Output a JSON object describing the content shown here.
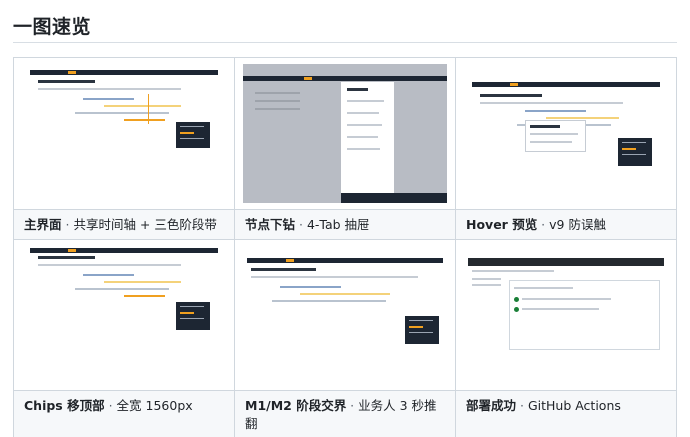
{
  "heading": "一图速览",
  "cards": [
    {
      "title": "主界面",
      "sep": " · ",
      "desc": "共享时间轴 + 三色阶段带"
    },
    {
      "title": "节点下钻",
      "sep": " · ",
      "desc": "4-Tab 抽屉"
    },
    {
      "title": "Hover 预览",
      "sep": " · ",
      "desc": "v9 防误触"
    },
    {
      "title": "Chips 移顶部",
      "sep": " · ",
      "desc": "全宽 1560px"
    },
    {
      "title": "M1/M2 阶段交界",
      "sep": " · ",
      "desc": "业务人 3 秒推翻"
    },
    {
      "title": "部署成功",
      "sep": " · ",
      "desc": "GitHub Actions"
    }
  ],
  "colors": {
    "accent": "#f0a020",
    "dark_bar": "#1d2633",
    "border": "#d0d7de",
    "caption_bg": "#f6f8fa"
  }
}
